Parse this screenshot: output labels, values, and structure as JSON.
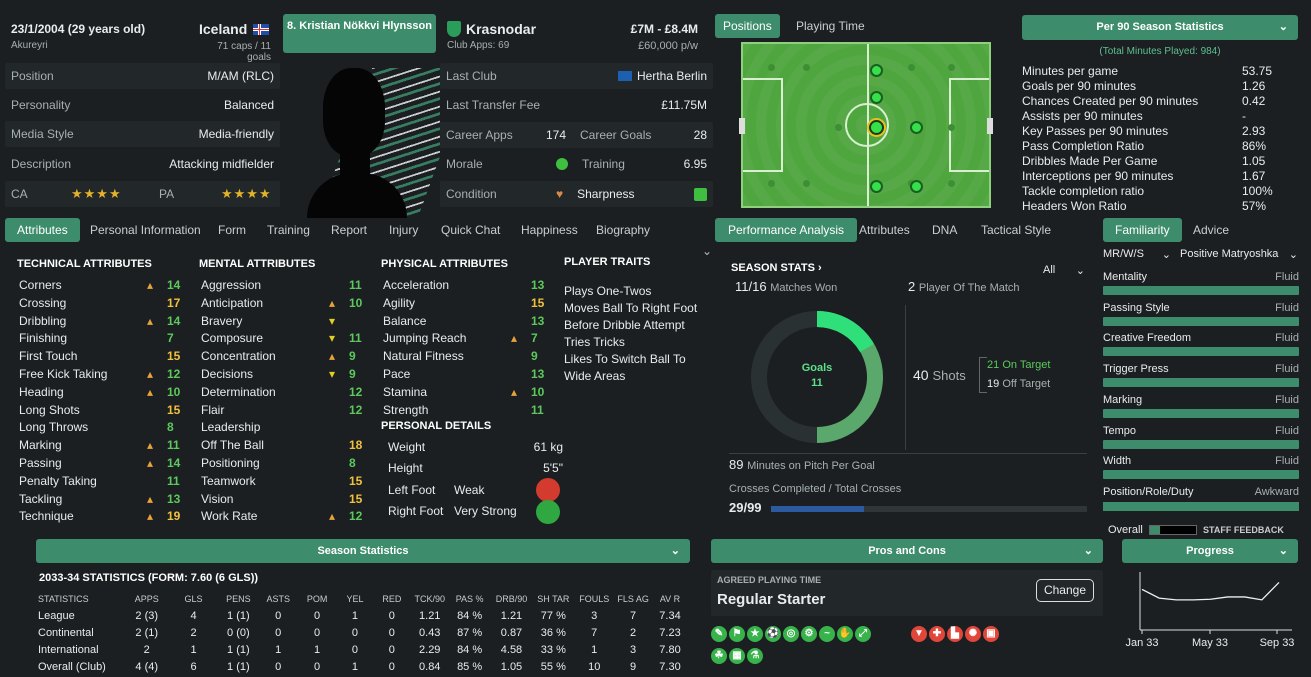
{
  "header": {
    "dob": "23/1/2004 (29 years old)",
    "birthplace": "Akureyri",
    "nation": "Iceland",
    "caps": "71 caps / 11 goals",
    "player_name": "8. Kristian Nökkvi Hlynsson",
    "club": "Krasnodar",
    "club_apps": "Club Apps: 69",
    "value": "£7M - £8.4M",
    "wage": "£60,000 p/w"
  },
  "left_info": [
    {
      "label": "Position",
      "value": "M/AM (RLC)"
    },
    {
      "label": "Personality",
      "value": "Balanced"
    },
    {
      "label": "Media Style",
      "value": "Media-friendly"
    },
    {
      "label": "Description",
      "value": "Attacking midfielder"
    }
  ],
  "ca_label": "CA",
  "pa_label": "PA",
  "ca_stars": "★★★★",
  "pa_stars": "★★★★",
  "mid_info": {
    "last_club_label": "Last Club",
    "last_club": "Hertha Berlin",
    "fee_label": "Last Transfer Fee",
    "fee": "£11.75M",
    "career_apps_label": "Career Apps",
    "career_apps": "174",
    "career_goals_label": "Career Goals",
    "career_goals": "28",
    "morale_label": "Morale",
    "training_label": "Training",
    "training": "6.95",
    "condition_label": "Condition",
    "sharpness_label": "Sharpness"
  },
  "top_tabs": {
    "positions": "Positions",
    "playing_time": "Playing Time"
  },
  "per90": {
    "title": "Per 90 Season Statistics",
    "subtitle": "(Total Minutes Played: 984)",
    "rows": [
      {
        "l": "Minutes per game",
        "v": "53.75"
      },
      {
        "l": "Goals per 90 minutes",
        "v": "1.26"
      },
      {
        "l": "Chances Created per 90 minutes",
        "v": "0.42"
      },
      {
        "l": "Assists per 90 minutes",
        "v": "-"
      },
      {
        "l": "Key Passes per 90 minutes",
        "v": "2.93"
      },
      {
        "l": "Pass Completion Ratio",
        "v": "86%"
      },
      {
        "l": "Dribbles Made Per Game",
        "v": "1.05"
      },
      {
        "l": "Interceptions per 90 minutes",
        "v": "1.67"
      },
      {
        "l": "Tackle completion ratio",
        "v": "100%"
      },
      {
        "l": "Headers Won Ratio",
        "v": "57%"
      }
    ]
  },
  "tabs": [
    "Attributes",
    "Personal Information",
    "Form",
    "Training",
    "Report",
    "Injury",
    "Quick Chat",
    "Happiness",
    "Biography"
  ],
  "technical": {
    "title": "TECHNICAL ATTRIBUTES",
    "items": [
      {
        "n": "Corners",
        "v": "14",
        "c": "g",
        "a": "up"
      },
      {
        "n": "Crossing",
        "v": "17",
        "c": "y",
        "a": ""
      },
      {
        "n": "Dribbling",
        "v": "14",
        "c": "g",
        "a": "up"
      },
      {
        "n": "Finishing",
        "v": "7",
        "c": "g",
        "a": ""
      },
      {
        "n": "First Touch",
        "v": "15",
        "c": "y",
        "a": ""
      },
      {
        "n": "Free Kick Taking",
        "v": "12",
        "c": "g",
        "a": "up"
      },
      {
        "n": "Heading",
        "v": "10",
        "c": "g",
        "a": "up"
      },
      {
        "n": "Long Shots",
        "v": "15",
        "c": "y",
        "a": ""
      },
      {
        "n": "Long Throws",
        "v": "8",
        "c": "g",
        "a": ""
      },
      {
        "n": "Marking",
        "v": "11",
        "c": "g",
        "a": "up"
      },
      {
        "n": "Passing",
        "v": "14",
        "c": "g",
        "a": "up"
      },
      {
        "n": "Penalty Taking",
        "v": "11",
        "c": "g",
        "a": ""
      },
      {
        "n": "Tackling",
        "v": "13",
        "c": "g",
        "a": "up"
      },
      {
        "n": "Technique",
        "v": "19",
        "c": "y",
        "a": "up"
      }
    ]
  },
  "mental": {
    "title": "MENTAL ATTRIBUTES",
    "items": [
      {
        "n": "Aggression",
        "v": "11",
        "c": "g",
        "a": ""
      },
      {
        "n": "Anticipation",
        "v": "10",
        "c": "g",
        "a": "up"
      },
      {
        "n": "Bravery",
        "v": "",
        "c": "g",
        "a": "dn"
      },
      {
        "n": "Composure",
        "v": "11",
        "c": "g",
        "a": "dn"
      },
      {
        "n": "Concentration",
        "v": "9",
        "c": "g",
        "a": "up"
      },
      {
        "n": "Decisions",
        "v": "9",
        "c": "g",
        "a": "dn"
      },
      {
        "n": "Determination",
        "v": "12",
        "c": "g",
        "a": ""
      },
      {
        "n": "Flair",
        "v": "12",
        "c": "g",
        "a": ""
      },
      {
        "n": "Leadership",
        "v": "",
        "c": "g",
        "a": ""
      },
      {
        "n": "Off The Ball",
        "v": "18",
        "c": "y",
        "a": ""
      },
      {
        "n": "Positioning",
        "v": "8",
        "c": "g",
        "a": ""
      },
      {
        "n": "Teamwork",
        "v": "15",
        "c": "y",
        "a": ""
      },
      {
        "n": "Vision",
        "v": "15",
        "c": "y",
        "a": ""
      },
      {
        "n": "Work Rate",
        "v": "12",
        "c": "g",
        "a": "up"
      }
    ]
  },
  "physical": {
    "title": "PHYSICAL ATTRIBUTES",
    "items": [
      {
        "n": "Acceleration",
        "v": "13",
        "c": "g",
        "a": ""
      },
      {
        "n": "Agility",
        "v": "15",
        "c": "y",
        "a": ""
      },
      {
        "n": "Balance",
        "v": "13",
        "c": "g",
        "a": ""
      },
      {
        "n": "Jumping Reach",
        "v": "7",
        "c": "g",
        "a": "up"
      },
      {
        "n": "Natural Fitness",
        "v": "9",
        "c": "g",
        "a": ""
      },
      {
        "n": "Pace",
        "v": "13",
        "c": "g",
        "a": ""
      },
      {
        "n": "Stamina",
        "v": "10",
        "c": "g",
        "a": "up"
      },
      {
        "n": "Strength",
        "v": "11",
        "c": "g",
        "a": ""
      }
    ]
  },
  "personal": {
    "title": "PERSONAL DETAILS",
    "weight_label": "Weight",
    "weight": "61 kg",
    "height_label": "Height",
    "height": "5'5\"",
    "left_foot_label": "Left Foot",
    "left_foot": "Weak",
    "right_foot_label": "Right Foot",
    "right_foot": "Very Strong"
  },
  "traits": {
    "title": "PLAYER TRAITS",
    "items": [
      "Plays One-Twos",
      "Moves Ball To Right Foot",
      "Before Dribble Attempt",
      "Tries Tricks",
      "Likes To Switch Ball To",
      "Wide Areas"
    ]
  },
  "perf_tabs": [
    "Performance Analysis",
    "Attributes",
    "DNA",
    "Tactical Style"
  ],
  "perf": {
    "title": "SEASON STATS",
    "filter": "All",
    "matches_won_num": "11/16",
    "matches_won": "Matches Won",
    "potm_num": "2",
    "potm": "Player Of The Match",
    "goals_label": "Goals",
    "goals": "11",
    "shots_num": "40",
    "shots": "Shots",
    "on_target_num": "21",
    "on_target": "On Target",
    "off_target_num": "19",
    "off_target": "Off Target",
    "mins_num": "89",
    "mins": "Minutes on Pitch Per Goal",
    "crosses_label": "Crosses Completed / Total Crosses",
    "crosses": "29/99"
  },
  "familiarity": {
    "tab1": "Familiarity",
    "tab2": "Advice",
    "formation": "MR/W/S",
    "style": "Positive Matryoshka",
    "rows": [
      {
        "l": "Mentality",
        "v": "Fluid"
      },
      {
        "l": "Passing Style",
        "v": "Fluid"
      },
      {
        "l": "Creative Freedom",
        "v": "Fluid"
      },
      {
        "l": "Trigger Press",
        "v": "Fluid"
      },
      {
        "l": "Marking",
        "v": "Fluid"
      },
      {
        "l": "Tempo",
        "v": "Fluid"
      },
      {
        "l": "Width",
        "v": "Fluid"
      }
    ],
    "prd_label": "Position/Role/Duty",
    "prd": "Awkward",
    "overall": "Overall",
    "staff": "STAFF FEEDBACK"
  },
  "season_stats": {
    "title": "Season Statistics",
    "form_title": "2033-34 STATISTICS (FORM: 7.60 (6 GLS))",
    "headers": [
      "STATISTICS",
      "APPS",
      "GLS",
      "PENS",
      "ASTS",
      "POM",
      "YEL",
      "RED",
      "TCK/90",
      "PAS %",
      "DRB/90",
      "SH TAR",
      "FOULS",
      "FLS AG",
      "AV R"
    ],
    "rows": [
      [
        "League",
        "2 (3)",
        "4",
        "1 (1)",
        "0",
        "0",
        "1",
        "0",
        "1.21",
        "84 %",
        "1.21",
        "77 %",
        "3",
        "7",
        "7.34"
      ],
      [
        "Continental",
        "2 (1)",
        "2",
        "0 (0)",
        "0",
        "0",
        "0",
        "0",
        "0.43",
        "87 %",
        "0.87",
        "36 %",
        "7",
        "2",
        "7.23"
      ],
      [
        "International",
        "2",
        "1",
        "1 (1)",
        "1",
        "1",
        "0",
        "0",
        "2.29",
        "84 %",
        "4.58",
        "33 %",
        "1",
        "3",
        "7.80"
      ],
      [
        "Overall (Club)",
        "4 (4)",
        "6",
        "1 (1)",
        "0",
        "0",
        "1",
        "0",
        "0.84",
        "85 %",
        "1.05",
        "55 %",
        "10",
        "9",
        "7.30"
      ]
    ]
  },
  "pros": {
    "title": "Pros and Cons",
    "agreed_label": "AGREED PLAYING TIME",
    "agreed": "Regular Starter",
    "change": "Change"
  },
  "progress": {
    "title": "Progress",
    "x_labels": [
      "Jan 33",
      "May 33",
      "Sep 33"
    ],
    "values": [
      0.7,
      0.55,
      0.52,
      0.52,
      0.53,
      0.57,
      0.57,
      0.52,
      0.82
    ]
  },
  "colors": {
    "accent": "#3d8c6c",
    "pitch": "#4faa3f",
    "up": "#e8a23a",
    "down": "#e0d020"
  }
}
